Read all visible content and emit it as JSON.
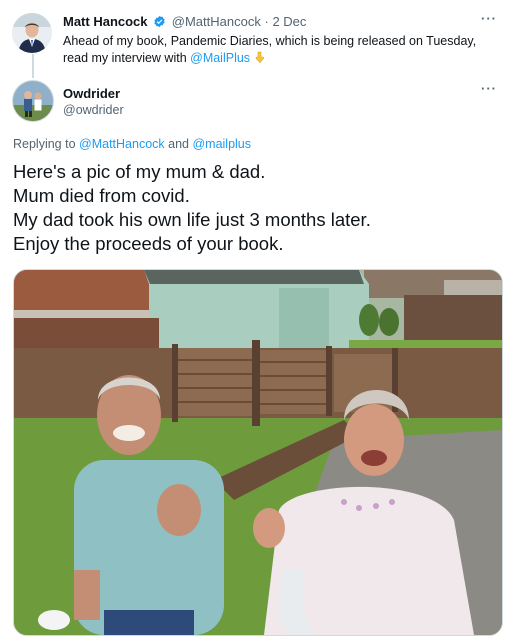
{
  "original_tweet": {
    "author_name": "Matt Hancock",
    "author_handle": "@MattHancock",
    "separator": "·",
    "date": "2 Dec",
    "more_icon": "···",
    "text_before_link": "Ahead of my book, Pandemic Diaries, which is being released on Tuesday, read my interview with ",
    "link_text": "@MailPlus",
    "emoji": "pointing-down-hand-icon",
    "verified_color": "#1d9bf0"
  },
  "reply_tweet": {
    "author_name": "Owdrider",
    "author_handle": "@owdrider",
    "more_icon": "···",
    "replying_prefix": "Replying to ",
    "replying_user1": "@MattHancock",
    "replying_and": " and ",
    "replying_user2": "@mailplus",
    "lines": [
      "Here's a pic of my mum & dad.",
      "Mum died from covid.",
      "My dad took his own life just 3 months later.",
      "Enjoy the proceeds of your book."
    ],
    "photo_icon": "garden-photo-icon"
  },
  "colors": {
    "link": "#1d9bf0",
    "secondary_text": "#536471",
    "primary_text": "#0f1419"
  }
}
